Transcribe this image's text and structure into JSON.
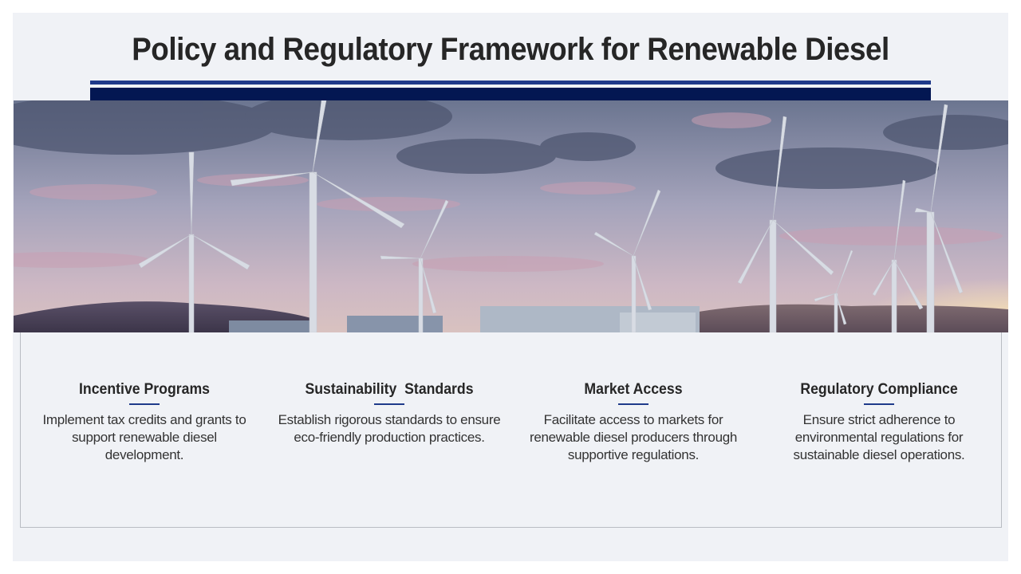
{
  "slide": {
    "title": "Policy and Regulatory Framework for Renewable Diesel"
  },
  "hero": {
    "image_subject": "wind-turbines-at-sunset"
  },
  "columns": [
    {
      "heading": "Incentive Programs",
      "body": "Implement tax credits and grants to support renewable diesel development."
    },
    {
      "heading": "Sustainability  Standards",
      "body": "Establish rigorous standards to ensure eco-friendly production practices."
    },
    {
      "heading": "Market Access",
      "body": "Facilitate access to markets for renewable diesel producers through supportive regulations."
    },
    {
      "heading": "Regulatory Compliance",
      "body": "Ensure strict adherence to environmental regulations for sustainable diesel operations."
    }
  ],
  "colors": {
    "accent_dark": "#031752",
    "accent": "#1f3a8a",
    "slide_background": "#f0f2f6",
    "text": "#262626"
  }
}
